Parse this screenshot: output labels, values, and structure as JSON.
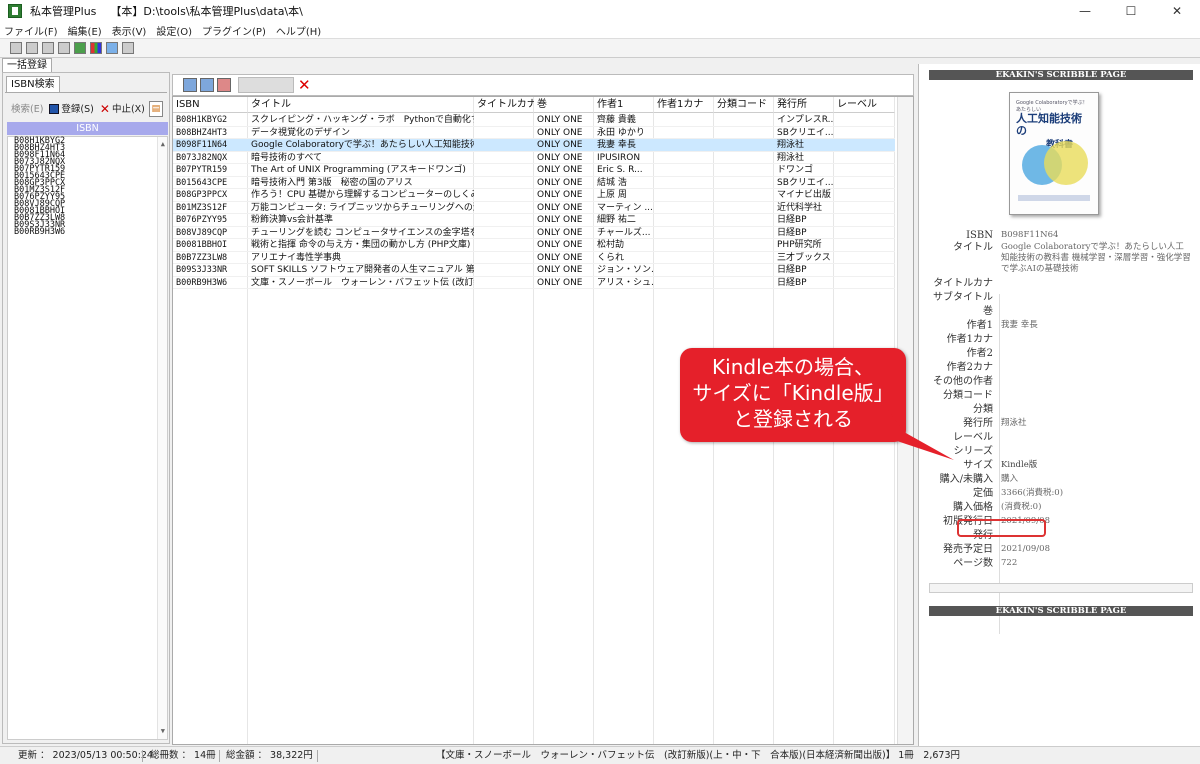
{
  "window": {
    "app_title": "私本管理Plus",
    "doc_title": "【本】D:\\tools\\私本管理Plus\\data\\本\\",
    "buttons": [
      "—",
      "☐",
      "✕"
    ]
  },
  "menu": [
    "ファイル(F)",
    "編集(E)",
    "表示(V)",
    "設定(O)",
    "プラグイン(P)",
    "ヘルプ(H)"
  ],
  "tabs": {
    "bulk": "一括登録"
  },
  "left": {
    "tab": "ISBN検索",
    "search_btn": "検索(E)",
    "register_btn": "登録(S)",
    "stop_btn": "中止(X)",
    "header": "ISBN",
    "items": [
      "B08H1KBYG2",
      "B08BHZ4HT3",
      "B098F11N64",
      "B073J82NQX",
      "B07PYTR159",
      "B015643CPE",
      "B08GP3PPCX",
      "B01MZ3S12F",
      "B076PZYY95",
      "B08VJ89CQP",
      "B0081BBHOI",
      "B0B7ZZ3LW8",
      "B09S3J33NR",
      "B00RB9H3W6"
    ]
  },
  "grid": {
    "headers": [
      "ISBN",
      "タイトル",
      "タイトルカナ",
      "巻",
      "作者1",
      "作者1カナ",
      "分類コード",
      "発行所",
      "レーベル"
    ],
    "rows": [
      [
        "B08H1KBYG2",
        "スクレイピング・ハッキング・ラボ　Pythonで自動化する...",
        "",
        "ONLY ONE",
        "齊藤 貴義",
        "",
        "",
        "インプレスR..."
      ],
      [
        "B08BHZ4HT3",
        "データ視覚化のデザイン",
        "",
        "ONLY ONE",
        "永田 ゆかり",
        "",
        "",
        "SBクリエイ..."
      ],
      [
        "B098F11N64",
        "Google Colaboratoryで学ぶ！あたらしい人工知能技術...",
        "",
        "ONLY ONE",
        "我妻 幸長",
        "",
        "",
        "翔泳社"
      ],
      [
        "B073J82NQX",
        "暗号技術のすべて",
        "",
        "ONLY ONE",
        "IPUSIRON",
        "",
        "",
        "翔泳社"
      ],
      [
        "B07PYTR159",
        "The Art of UNIX Programming (アスキードワンゴ)",
        "",
        "ONLY ONE",
        "Eric S. R...",
        "",
        "",
        "ドワンゴ"
      ],
      [
        "B015643CPE",
        "暗号技術入門 第3版　秘密の国のアリス",
        "",
        "ONLY ONE",
        "結城 浩",
        "",
        "",
        "SBクリエイ..."
      ],
      [
        "B08GP3PPCX",
        "作ろう！CPU 基礎から理解するコンピューターのしくみ ...",
        "",
        "ONLY ONE",
        "上原 周",
        "",
        "",
        "マイナビ出版"
      ],
      [
        "B01MZ3S12F",
        "万能コンピュータ: ライプニッツからチューリングへの道...",
        "",
        "ONLY ONE",
        "マーティン ...",
        "",
        "",
        "近代科学社"
      ],
      [
        "B076PZYY95",
        "粉飾決算vs会計基準",
        "",
        "ONLY ONE",
        "細野 祐二",
        "",
        "",
        "日経BP"
      ],
      [
        "B08VJ89CQP",
        "チューリングを読む コンピュータサイエンスの金字塔を...",
        "",
        "ONLY ONE",
        "チャールズ...",
        "",
        "",
        "日経BP"
      ],
      [
        "B0081BBHOI",
        "戦術と指揮 命令の与え方・集団の動かし方 (PHP文庫)",
        "",
        "ONLY ONE",
        "松村劼",
        "",
        "",
        "PHP研究所"
      ],
      [
        "B0B7ZZ3LW8",
        "アリエナイ毒性学事典",
        "",
        "ONLY ONE",
        "くられ",
        "",
        "",
        "三才ブックス"
      ],
      [
        "B09S3J33NR",
        "SOFT SKILLS ソフトウェア開発者の人生マニュアル 第...",
        "",
        "ONLY ONE",
        "ジョン・ソン...",
        "",
        "",
        "日経BP"
      ],
      [
        "B00RB9H3W6",
        "文庫・スノーボール　ウォーレン・バフェット伝 (改訂新...",
        "",
        "ONLY ONE",
        "アリス・シュ...",
        "",
        "",
        "日経BP"
      ]
    ]
  },
  "right": {
    "banner": "EKAKIN'S SCRIBBLE PAGE",
    "cover": {
      "small": "Google Colaboratoryで学ぶ！あたらしい",
      "title": "人工知能技術の",
      "title2": "教科書"
    },
    "fields": [
      {
        "label": "ISBN",
        "value": "B098F11N64"
      },
      {
        "label": "タイトル",
        "value": "Google Colaboratoryで学ぶ！あたらしい人工知能技術の教科書 機械学習・深層学習・強化学習で学ぶAIの基礎技術"
      },
      {
        "label": "タイトルカナ",
        "value": ""
      },
      {
        "label": "サブタイトル",
        "value": ""
      },
      {
        "label": "巻",
        "value": ""
      },
      {
        "label": "作者1",
        "value": "我妻 幸長"
      },
      {
        "label": "作者1カナ",
        "value": ""
      },
      {
        "label": "作者2",
        "value": ""
      },
      {
        "label": "作者2カナ",
        "value": ""
      },
      {
        "label": "その他の作者",
        "value": ""
      },
      {
        "label": "分類コード",
        "value": ""
      },
      {
        "label": "分類",
        "value": ""
      },
      {
        "label": "発行所",
        "value": "翔泳社"
      },
      {
        "label": "レーベル",
        "value": ""
      },
      {
        "label": "シリーズ",
        "value": ""
      },
      {
        "label": "サイズ",
        "value": "Kindle版"
      },
      {
        "label": "購入/未購入",
        "value": "購入"
      },
      {
        "label": "定価",
        "value": "3366(消費税:0)"
      },
      {
        "label": "購入価格",
        "value": "(消費税:0)"
      },
      {
        "label": "初版発行日",
        "value": "2021/09/08"
      },
      {
        "label": "発行",
        "value": ""
      },
      {
        "label": "発売予定日",
        "value": "2021/09/08"
      },
      {
        "label": "ページ数",
        "value": "722"
      }
    ]
  },
  "callout": {
    "line1": "Kindle本の場合、",
    "line2": "サイズに「Kindle版」",
    "line3": "と登録される"
  },
  "status": {
    "updated": "更新 ： 2023/05/13 00:50:24",
    "total_count": "総冊数 ： 14冊",
    "total_amount": "総金額 ： 38,322円",
    "current": "【文庫・スノーボール　ウォーレン・バフェット伝　(改訂新版)(上・中・下　合本版)(日本経済新聞出版)】 1冊　2,673円"
  },
  "colors": {
    "accent": "#a7a9ec",
    "selected_row": "#cce8ff",
    "callout": "#e5202a"
  }
}
